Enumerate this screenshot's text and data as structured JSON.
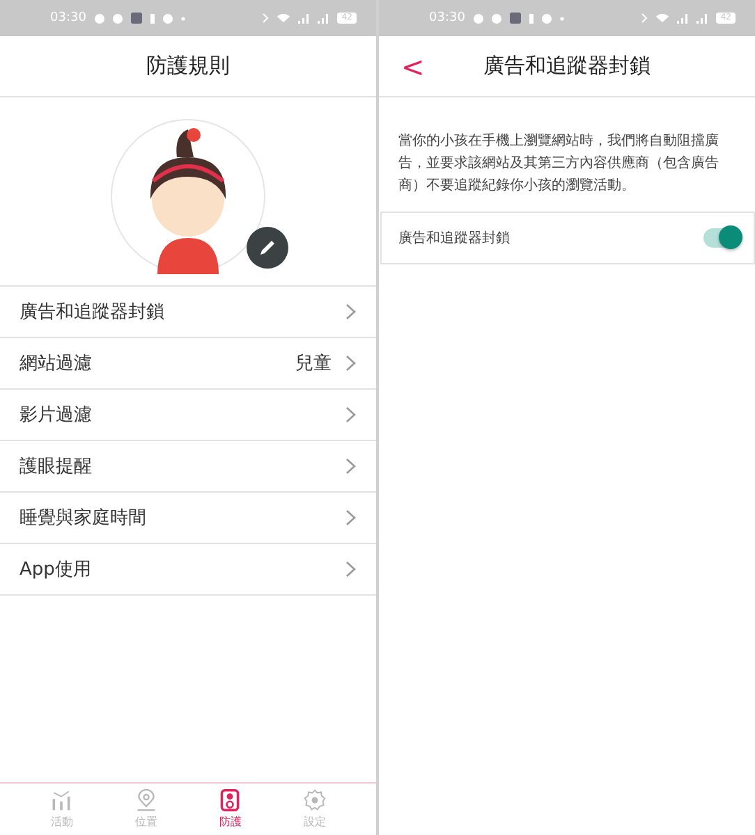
{
  "left_screen": {
    "status_bar": {
      "time": "03:30",
      "battery": "42"
    },
    "title": "防護規則",
    "menu": [
      {
        "label": "廣告和追蹤器封鎖"
      },
      {
        "label": "網站過濾",
        "value": "兒童"
      },
      {
        "label": "影片過濾"
      },
      {
        "label": "護眼提醒"
      },
      {
        "label": "睡覺與家庭時間"
      },
      {
        "label": "App使用"
      }
    ],
    "bottom_nav": [
      {
        "label": "活動",
        "selected": false
      },
      {
        "label": "位置",
        "selected": false
      },
      {
        "label": "防護",
        "selected": true
      },
      {
        "label": "設定",
        "selected": false
      }
    ]
  },
  "right_screen": {
    "status_bar": {
      "time": "03:30",
      "battery": "42"
    },
    "title": "廣告和追蹤器封鎖",
    "back": "<",
    "description": "當你的小孩在手機上瀏覽網站時，我們將自動阻擋廣告，並要求該網站及其第三方內容供應商（包含廣告商）不要追蹤紀錄你小孩的瀏覽活動。",
    "setting": {
      "label": "廣告和追蹤器封鎖",
      "on": true
    }
  }
}
